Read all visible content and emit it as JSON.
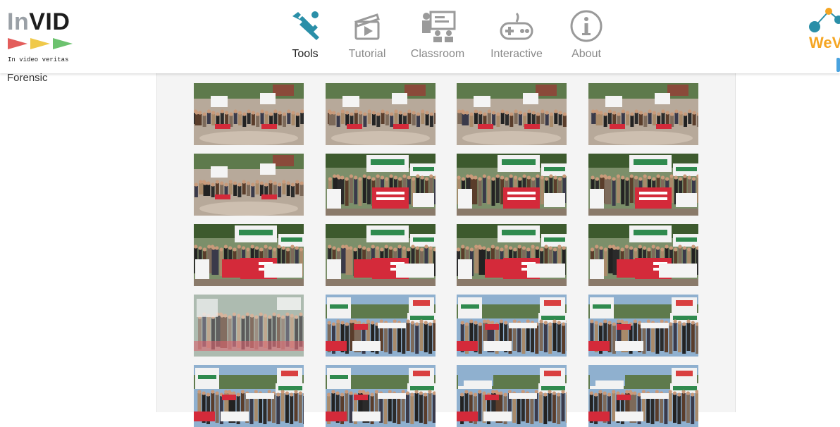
{
  "logo": {
    "title_in": "In",
    "title_vid": "VID",
    "tagline": "In video veritas"
  },
  "nav": [
    {
      "label": "Tools",
      "icon": "wrench-screwdriver-icon",
      "active": true
    },
    {
      "label": "Tutorial",
      "icon": "clapperboard-icon",
      "active": false
    },
    {
      "label": "Classroom",
      "icon": "classroom-icon",
      "active": false
    },
    {
      "label": "Interactive",
      "icon": "gamepad-icon",
      "active": false
    },
    {
      "label": "About",
      "icon": "info-icon",
      "active": false
    }
  ],
  "brand_right": {
    "text": "WeV"
  },
  "sidebar": {
    "label": "Forensic"
  },
  "thumbnails": {
    "rows": [
      [
        "plaza-crowd",
        "plaza-crowd",
        "plaza-crowd",
        "plaza-crowd"
      ],
      [
        "plaza-crowd",
        "pakistan-banner",
        "pakistan-banner",
        "pakistan-banner"
      ],
      [
        "pakistan-banner-close",
        "pakistan-banner-close",
        "pakistan-banner-close",
        "pakistan-banner-close"
      ],
      [
        "blurred-transition",
        "ena-protest",
        "ena-protest",
        "ena-protest"
      ],
      [
        "ena-protest",
        "ena-protest",
        "ena-protest-wide",
        "ena-protest-wide"
      ]
    ]
  },
  "colors": {
    "accent_teal": "#2a8fa8",
    "banner_red": "#d42a3a",
    "banner_green": "#2f8a4e",
    "panel_bg": "#f4f4f4"
  }
}
